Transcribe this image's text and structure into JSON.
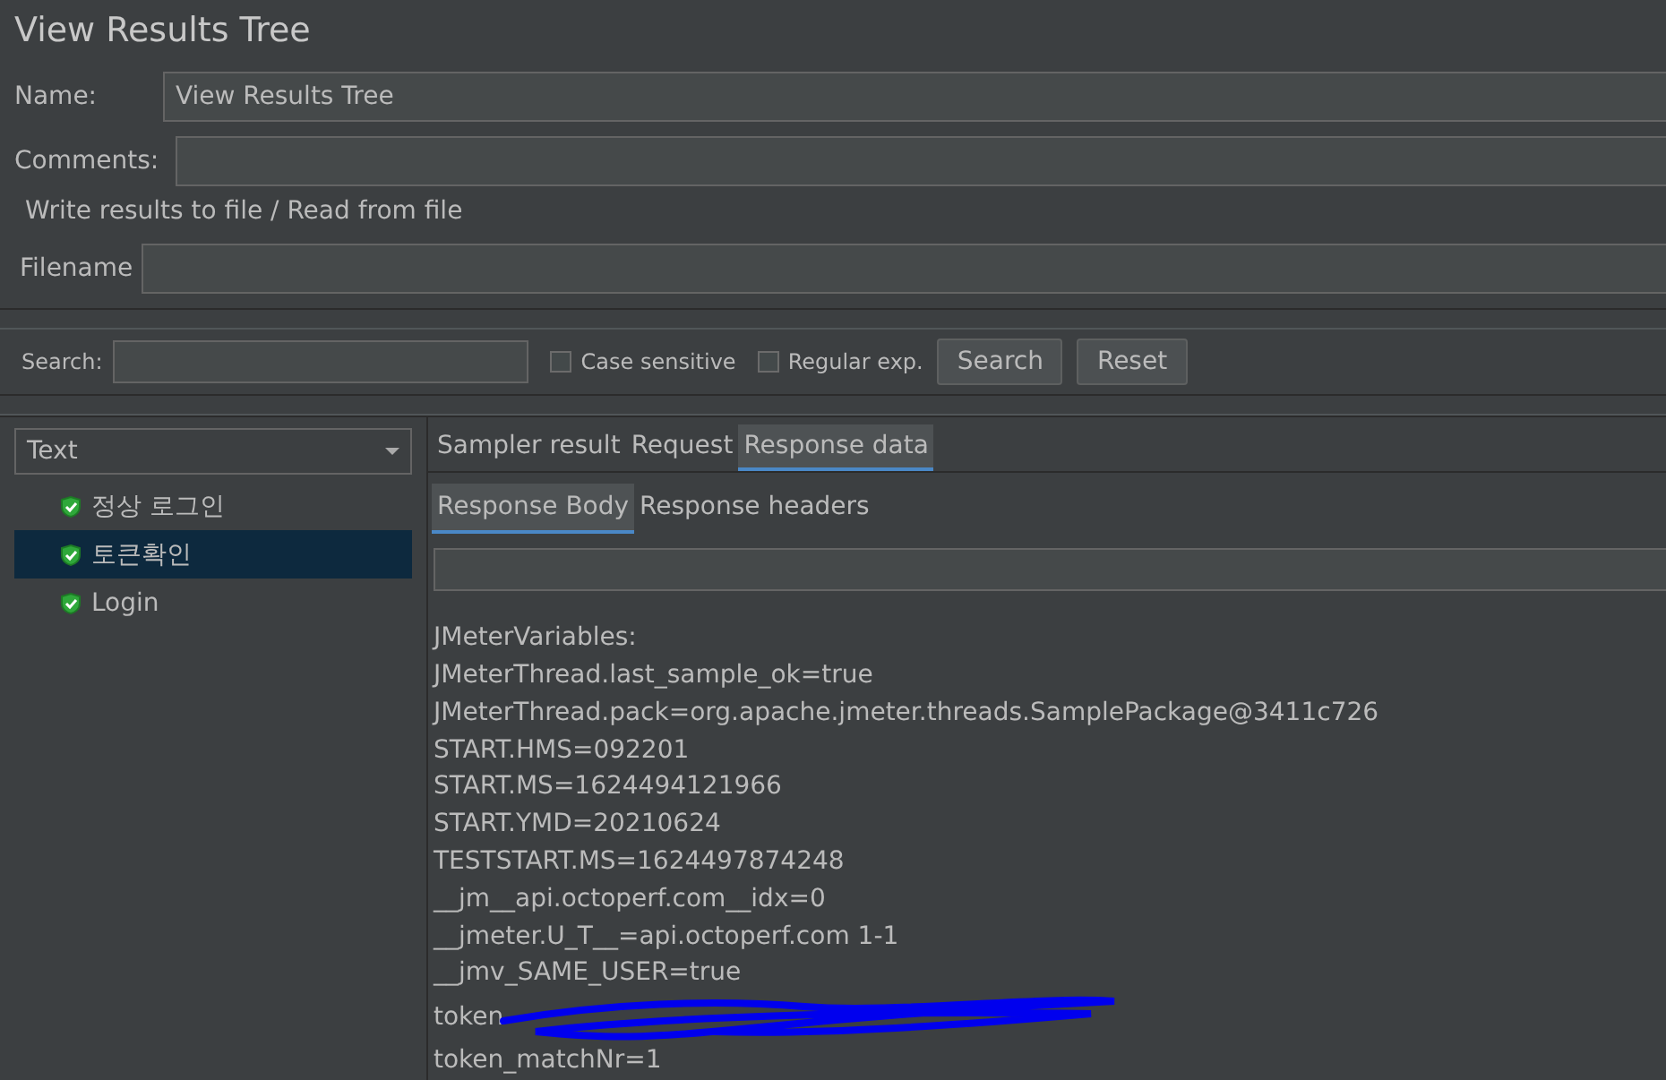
{
  "window": {
    "title": "View Results Tree"
  },
  "name_field": {
    "label": "Name:",
    "value": "View Results Tree"
  },
  "comments_field": {
    "label": "Comments:"
  },
  "file_section": {
    "title": "Write results to file / Read from file",
    "filename_label": "Filename"
  },
  "search": {
    "label": "Search:",
    "options": [
      {
        "label": "Case sensitive",
        "checked": false
      },
      {
        "label": "Regular exp.",
        "checked": false
      }
    ],
    "buttons": [
      "Search",
      "Reset"
    ]
  },
  "renderer": {
    "value": "Text"
  },
  "samples": [
    {
      "label": "정상 로그인",
      "selected": false
    },
    {
      "label": "토큰확인",
      "selected": true
    },
    {
      "label": "Login",
      "selected": false
    }
  ],
  "tabs": [
    {
      "label": "Sampler result",
      "selected": false
    },
    {
      "label": "Request",
      "selected": false
    },
    {
      "label": "Response data",
      "selected": true
    }
  ],
  "subtabs": [
    {
      "label": "Response Body",
      "selected": true
    },
    {
      "label": "Response headers",
      "selected": false
    }
  ],
  "body_lines": [
    {
      "text": "JMeterVariables:",
      "redacted": false
    },
    {
      "text": "JMeterThread.last_sample_ok=true",
      "redacted": false
    },
    {
      "text": "JMeterThread.pack=org.apache.jmeter.threads.SamplePackage@3411c726",
      "redacted": false
    },
    {
      "text": "START.HMS=092201",
      "redacted": false
    },
    {
      "text": "START.MS=1624494121966",
      "redacted": false
    },
    {
      "text": "START.YMD=20210624",
      "redacted": false
    },
    {
      "text": "TESTSTART.MS=1624497874248",
      "redacted": false
    },
    {
      "text": "__jm__api.octoperf.com__idx=0",
      "redacted": false
    },
    {
      "text": "__jmeter.U_T__=api.octoperf.com 1-1",
      "redacted": false
    },
    {
      "text": "__jmv_SAME_USER=true",
      "redacted": false
    },
    {
      "text": "token",
      "redacted": true
    },
    {
      "text": "token_matchNr=1",
      "redacted": false
    }
  ]
}
